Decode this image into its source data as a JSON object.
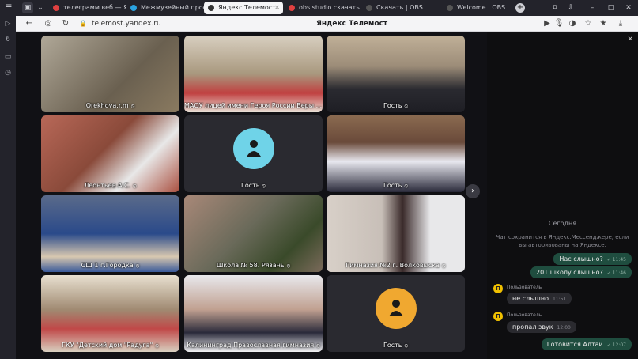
{
  "browser": {
    "tabs": [
      {
        "label": "телеграмм веб — Я",
        "color": "#e04040",
        "active": false
      },
      {
        "label": "Межмузейный проект",
        "color": "#2aa3e0",
        "active": false
      },
      {
        "label": "Яндекс Телемост",
        "color": "#333333",
        "active": true
      },
      {
        "label": "obs studio скачать — Я",
        "color": "#e04040",
        "active": false
      },
      {
        "label": "Скачать | OBS",
        "color": "#555555",
        "active": false
      },
      {
        "label": "Welcome | OBS",
        "color": "#555555",
        "active": false
      }
    ],
    "url": "telemost.yandex.ru",
    "page_title": "Яндекс Телемост"
  },
  "participants": [
    {
      "name": "Orekhova.r.m",
      "bg": "#8a8070",
      "avatar": false
    },
    {
      "name": "МАОУ лицей имени Героя России Веры ...",
      "bg": "#b9aa92",
      "avatar": false
    },
    {
      "name": "Гость",
      "bg": "#9c8c78",
      "avatar": false
    },
    {
      "name": "Леонтьев А.С.",
      "bg": "#a85a4a",
      "avatar": false
    },
    {
      "name": "Гость",
      "bg": "#2a2a30",
      "avatar": true,
      "avatar_color": "#6fd3e8"
    },
    {
      "name": "Гость",
      "bg": "#7a5e4a",
      "avatar": false
    },
    {
      "name": "СШ 1 г.Городка",
      "bg": "#3a5a8a",
      "avatar": false
    },
    {
      "name": "Школа № 58. Рязань",
      "bg": "#6a6a5a",
      "avatar": false
    },
    {
      "name": "Гимназия №2 г. Волковыска",
      "bg": "#c8bfb8",
      "avatar": false
    },
    {
      "name": "ГКУ \"Детский дом \"Радуга\"",
      "bg": "#a08a72",
      "avatar": false
    },
    {
      "name": "Калининград Православная гимназия",
      "bg": "#c0a090",
      "avatar": false
    },
    {
      "name": "Гость",
      "bg": "#2a2a30",
      "avatar": true,
      "avatar_color": "#f0a830"
    }
  ],
  "chat": {
    "day_label": "Сегодня",
    "notice": "Чат сохранится в Яндекс.Мессенджере, если вы авторизованы на Яндексе.",
    "messages": [
      {
        "dir": "out",
        "text": "Нас слышно?",
        "time": "✓ 11:45"
      },
      {
        "dir": "out",
        "text": "201 школу слышно?",
        "time": "✓ 11:46"
      },
      {
        "dir": "in",
        "author": "Пользователь",
        "text": "не слышно",
        "time": "11:51"
      },
      {
        "dir": "in",
        "author": "Пользователь",
        "text": "пропал звук",
        "time": "12:00"
      },
      {
        "dir": "out",
        "text": "Готовится Алтай",
        "time": "✓ 12:07"
      }
    ]
  }
}
